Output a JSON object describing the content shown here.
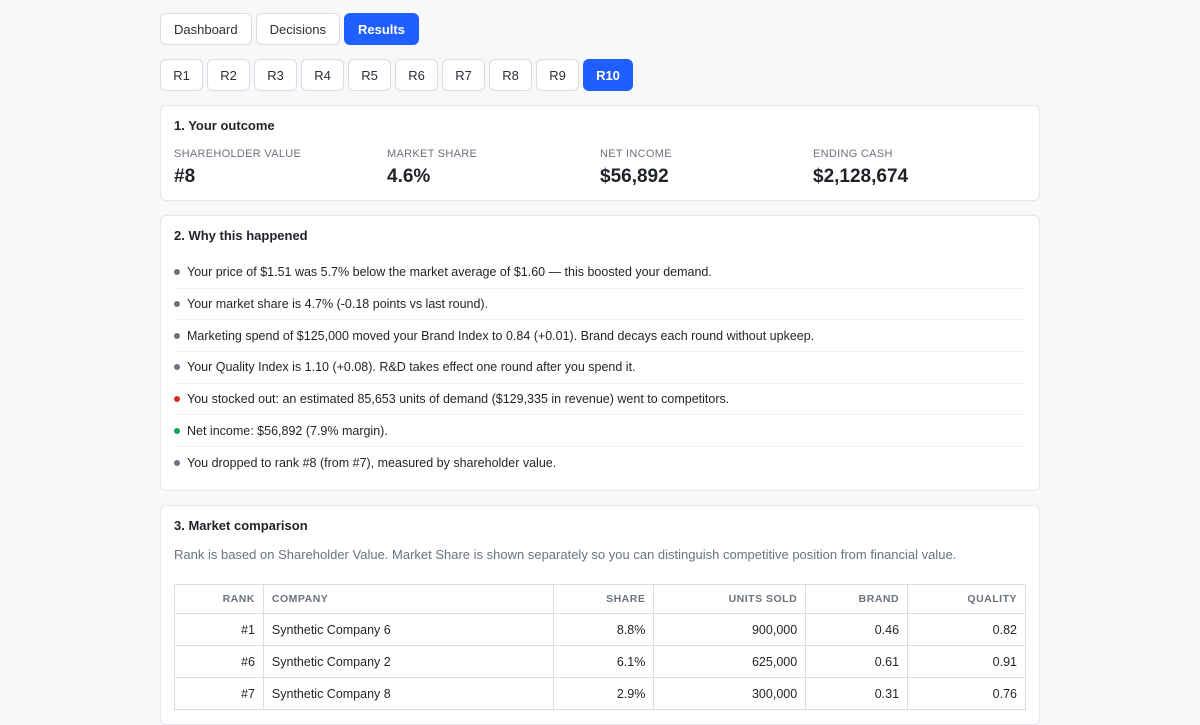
{
  "tabs": [
    {
      "label": "Dashboard",
      "active": false
    },
    {
      "label": "Decisions",
      "active": false
    },
    {
      "label": "Results",
      "active": true
    }
  ],
  "rounds": [
    {
      "label": "R1",
      "active": false
    },
    {
      "label": "R2",
      "active": false
    },
    {
      "label": "R3",
      "active": false
    },
    {
      "label": "R4",
      "active": false
    },
    {
      "label": "R5",
      "active": false
    },
    {
      "label": "R6",
      "active": false
    },
    {
      "label": "R7",
      "active": false
    },
    {
      "label": "R8",
      "active": false
    },
    {
      "label": "R9",
      "active": false
    },
    {
      "label": "R10",
      "active": true
    }
  ],
  "outcome": {
    "title": "1. Your outcome",
    "metrics": [
      {
        "label": "SHAREHOLDER VALUE",
        "value": "#8"
      },
      {
        "label": "MARKET SHARE",
        "value": "4.6%"
      },
      {
        "label": "NET INCOME",
        "value": "$56,892"
      },
      {
        "label": "ENDING CASH",
        "value": "$2,128,674"
      }
    ]
  },
  "why": {
    "title": "2. Why this happened",
    "items": [
      {
        "text": "Your price of $1.51 was 5.7% below the market average of $1.60 — this boosted your demand.",
        "tone": "neutral"
      },
      {
        "text": "Your market share is 4.7% (-0.18 points vs last round).",
        "tone": "neutral"
      },
      {
        "text": "Marketing spend of $125,000 moved your Brand Index to 0.84 (+0.01). Brand decays each round without upkeep.",
        "tone": "neutral"
      },
      {
        "text": "Your Quality Index is 1.10 (+0.08). R&D takes effect one round after you spend it.",
        "tone": "neutral"
      },
      {
        "text": "You stocked out: an estimated 85,653 units of demand ($129,335 in revenue) went to competitors.",
        "tone": "negative"
      },
      {
        "text": "Net income: $56,892 (7.9% margin).",
        "tone": "positive"
      },
      {
        "text": "You dropped to rank #8 (from #7), measured by shareholder value.",
        "tone": "neutral"
      }
    ]
  },
  "comparison": {
    "title": "3. Market comparison",
    "note": "Rank is based on Shareholder Value. Market Share is shown separately so you can distinguish competitive position from financial value.",
    "columns": [
      "RANK",
      "COMPANY",
      "SHARE",
      "UNITS SOLD",
      "BRAND",
      "QUALITY"
    ],
    "rows": [
      {
        "rank": "#1",
        "company": "Synthetic Company 6",
        "share": "8.8%",
        "units": "900,000",
        "brand": "0.46",
        "quality": "0.82"
      },
      {
        "rank": "#6",
        "company": "Synthetic Company 2",
        "share": "6.1%",
        "units": "625,000",
        "brand": "0.61",
        "quality": "0.91"
      },
      {
        "rank": "#7",
        "company": "Synthetic Company 8",
        "share": "2.9%",
        "units": "300,000",
        "brand": "0.31",
        "quality": "0.76"
      }
    ]
  },
  "colors": {
    "accent": "#1f5eff",
    "dot_neutral": "#6b7280",
    "dot_negative": "#d92d20",
    "dot_positive": "#12a05a"
  }
}
